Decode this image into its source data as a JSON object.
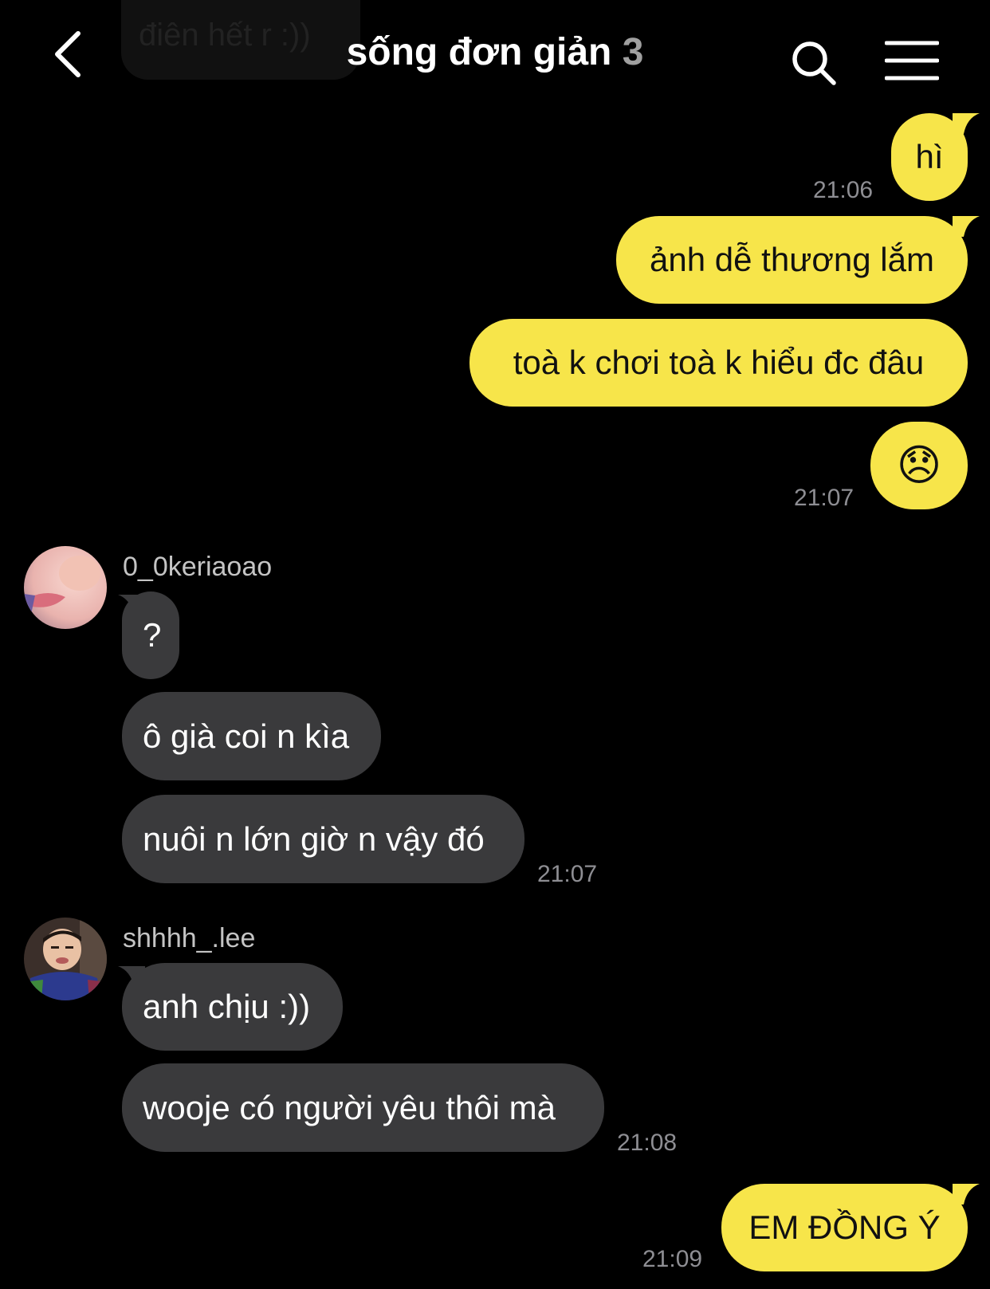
{
  "header": {
    "ghost_message": "điên hết r :))",
    "title": "sống đơn giản",
    "member_count": "3",
    "back_icon": "chevron-left-icon",
    "search_icon": "search-icon",
    "menu_icon": "hamburger-menu-icon"
  },
  "colors": {
    "outgoing_bubble": "#f7e54a",
    "incoming_bubble": "#3a3a3c",
    "background": "#000000",
    "timestamp": "#8e8e93"
  },
  "messages": {
    "m1": {
      "text": "hì",
      "time": "21:06"
    },
    "m2": {
      "text": "ảnh dễ thương lắm"
    },
    "m3": {
      "text": "toà k chơi toà k hiểu đc đâu"
    },
    "m4": {
      "text": "😞",
      "time": "21:07"
    },
    "group1": {
      "sender": "0_0keriaoao",
      "m5": {
        "text": "?"
      },
      "m6": {
        "text": "ô già coi n kìa"
      },
      "m7": {
        "text": "nuôi n lớn giờ n vậy đó",
        "time": "21:07"
      }
    },
    "group2": {
      "sender": "shhhh_.lee",
      "m8": {
        "text": "anh chịu :))"
      },
      "m9": {
        "text": "wooje có người yêu thôi mà",
        "time": "21:08"
      }
    },
    "m10": {
      "text": "EM ĐỒNG Ý",
      "time": "21:09"
    }
  }
}
